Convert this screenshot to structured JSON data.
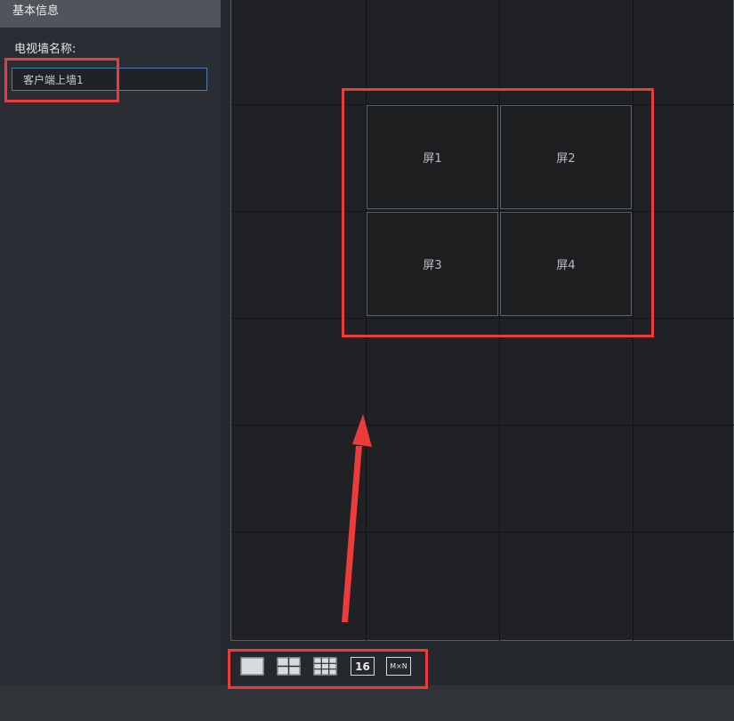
{
  "panel": {
    "header": "基本信息",
    "wall_name_label": "电视墙名称:",
    "wall_name_value": "客户端上墙1"
  },
  "screens": [
    {
      "label": "屏1"
    },
    {
      "label": "屏2"
    },
    {
      "label": "屏3"
    },
    {
      "label": "屏4"
    }
  ],
  "toolbar": {
    "layouts": [
      {
        "icon": "single-screen-layout-icon",
        "label": ""
      },
      {
        "icon": "grid-2x2-layout-icon",
        "label": ""
      },
      {
        "icon": "grid-3x3-layout-icon",
        "label": ""
      },
      {
        "icon": "grid-16-layout-icon",
        "label": "16"
      },
      {
        "icon": "custom-mxn-layout-icon",
        "label": "M×N"
      }
    ]
  },
  "colors": {
    "annotation": "#ec3b3b",
    "input_border": "#4d7dae"
  }
}
